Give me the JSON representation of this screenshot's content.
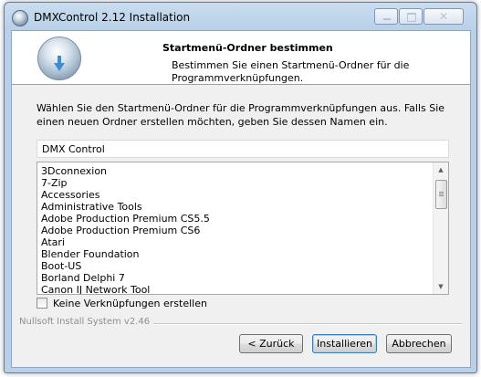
{
  "window": {
    "title": "DMXControl 2.12 Installation"
  },
  "header": {
    "title": "Startmenü-Ordner bestimmen",
    "subtitle": "Bestimmen Sie einen Startmenü-Ordner für die Programmverknüpfungen."
  },
  "description": "Wählen Sie den Startmenü-Ordner für die Programmverknüpfungen aus. Falls Sie einen neuen Ordner erstellen möchten, geben Sie dessen Namen ein.",
  "folder_input": {
    "value": "DMX Control"
  },
  "folders": [
    "3Dconnexion",
    "7-Zip",
    "Accessories",
    "Administrative Tools",
    "Adobe Production Premium CS5.5",
    "Adobe Production Premium CS6",
    "Atari",
    "Blender Foundation",
    "Boot-US",
    "Borland Delphi 7",
    "Canon IJ Network Tool"
  ],
  "no_shortcuts_checkbox": {
    "label": "Keine Verknüpfungen erstellen",
    "checked": false
  },
  "branding": "Nullsoft Install System v2.46",
  "buttons": {
    "back": "< Zurück",
    "install": "Installieren",
    "cancel": "Abbrechen"
  },
  "icons": {
    "app": "installer-disc-icon",
    "header": "install-disc-icon",
    "scroll_up": "chevron-up-icon",
    "scroll_down": "chevron-down-icon"
  }
}
